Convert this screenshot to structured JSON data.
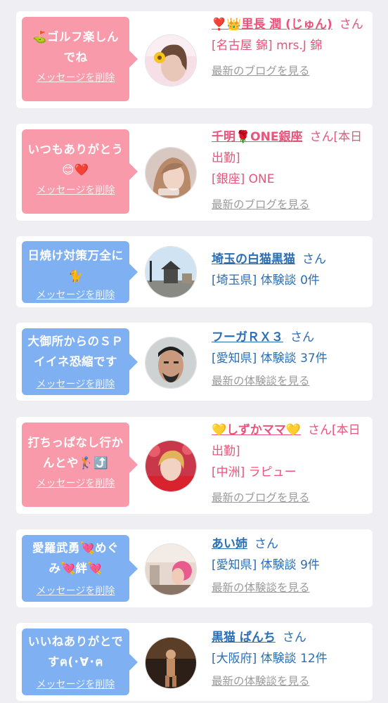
{
  "messages": [
    {
      "bubble_text": "⛳ゴルフ楽しんでね",
      "delete_label": "メッセージを削除",
      "name": "❣️👑里長 潤 (じゅん)",
      "suffix": "さん",
      "location": "[名古屋 錦] mrs.J 錦",
      "link": "最新のブログを見る",
      "color": "#f99aab"
    },
    {
      "bubble_text": "いつもありがとう😊❤️",
      "delete_label": "メッセージを削除",
      "name": "千明🌹ONE銀座",
      "suffix": "さん[本日出勤]",
      "location": "[銀座] ONE",
      "link": "最新のブログを見る",
      "color": "#f99aab"
    },
    {
      "bubble_text": "日焼け対策万全に🐈",
      "delete_label": "メッセージを削除",
      "name": "埼玉の白猫黒猫",
      "suffix": "さん",
      "location": "[埼玉県] 体験談 0件",
      "link": "",
      "color": "#7fb0f1"
    },
    {
      "bubble_text": "大御所からのＳＰイイネ恐縮です",
      "delete_label": "メッセージを削除",
      "name": "フーガＲＸ３",
      "suffix": "さん",
      "location": "[愛知県] 体験談 37件",
      "link": "最新の体験談を見る",
      "color": "#7fb0f1"
    },
    {
      "bubble_text": "打ちっぱなし行かんとや🏌️⤴️",
      "delete_label": "メッセージを削除",
      "name": "💛しずかママ💛",
      "suffix": "さん[本日出勤]",
      "location": "[中洲] ラピュー",
      "link": "最新のブログを見る",
      "color": "#f99aab"
    },
    {
      "bubble_text": "愛羅武勇💘めぐみ💘絆💘",
      "delete_label": "メッセージを削除",
      "name": "あい姉",
      "suffix": "さん",
      "location": "[愛知県] 体験談 9件",
      "link": "最新の体験談を見る",
      "color": "#7fb0f1"
    },
    {
      "bubble_text": "いいねありがとですฅ(･∀･ฅ",
      "delete_label": "メッセージを削除",
      "name": "黒猫 ぱんち",
      "suffix": "さん",
      "location": "[大阪府] 体験談 12件",
      "link": "最新の体験談を見る",
      "color": "#7fb0f1"
    }
  ]
}
